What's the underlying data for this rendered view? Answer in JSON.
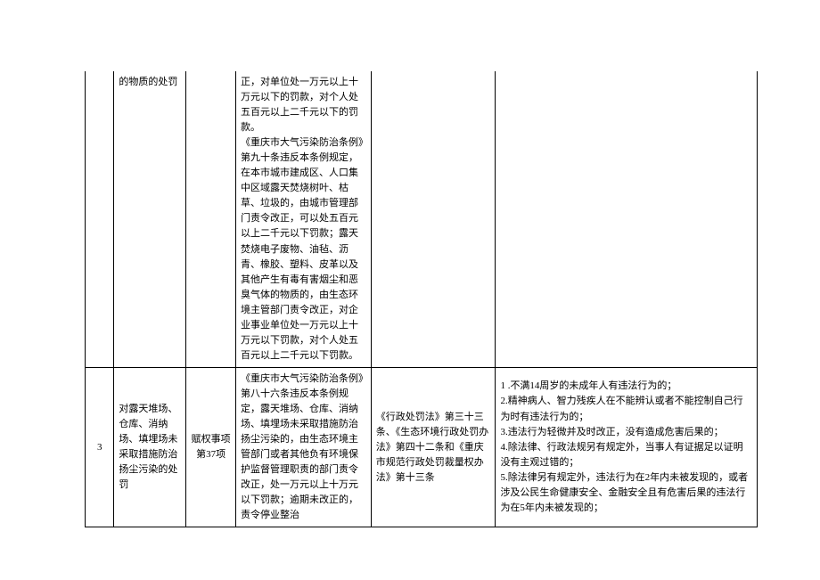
{
  "rows": [
    {
      "idx": "",
      "name": "的物质的处罚",
      "auth": "",
      "basis": "正，对单位处一万元以上十万元以下的罚款，对个人处五百元以上二千元以下的罚款。\n《重庆市大气污染防治条例》第九十条违反本条例规定，在本市城市建成区、人口集中区域露天焚烧树叶、枯草、垃圾的，由城市管理部门责令改正，可以处五百元以上二千元以下罚款；露天焚烧电子废物、油毡、沥青、橡胶、塑料、皮革以及其他产生有毒有害烟尘和恶臭气体的物质的，由生态环境主管部门责令改正，对企业事业单位处一万元以上十万元以下罚款，对个人处五百元以上二千元以下罚款。",
      "proc": "",
      "disc": ""
    },
    {
      "idx": "3",
      "name": "对露天堆场、仓库、消纳场、填埋场未采取措施防治扬尘污染的处罚",
      "auth": "赋权事项第37项",
      "basis": "《重庆市大气污染防治条例》第八十六条违反本条例规定，露天堆场、仓库、消纳场、填埋场未采取措施防治扬尘污染的，由生态环境主管部门或者其他负有环境保护监督管理职责的部门责令改正，处一万元以上十万元以下罚款；逾期未改正的，责令停业整治",
      "proc": "《行政处罚法》第三十三条、《生态环境行政处罚办法》第四十二条和《重庆市规范行政处罚裁量权办法》第十三条",
      "disc": "1 .不满14周岁的未成年人有违法行为的；\n2.精神病人、智力残疾人在不能辨认或者不能控制自己行为时有违法行为的；\n3.违法行为轻微并及时改正，没有造成危害后果的；\n4.除法律、行政法规另有规定外，当事人有证据足以证明没有主观过错的；\n5.除法律另有规定外，违法行为在2年内未被发现的，或者涉及公民生命健康安全、金融安全且有危害后果的违法行为在5年内未被发现的；"
    }
  ]
}
